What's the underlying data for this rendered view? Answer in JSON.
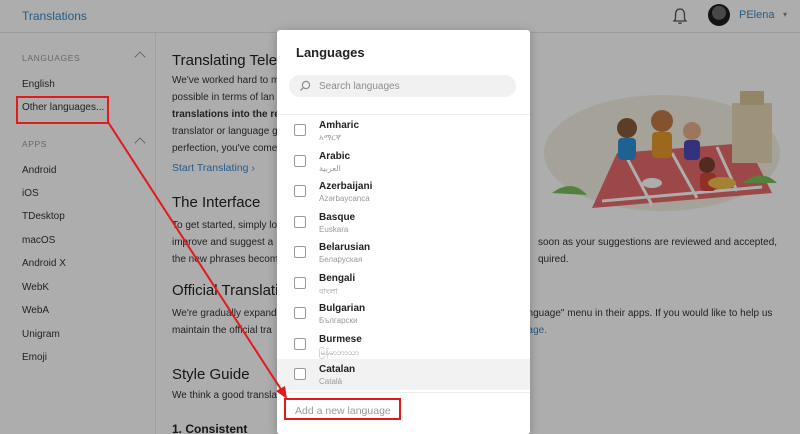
{
  "topbar": {
    "brand": "Translations",
    "username": "PElena",
    "bell_icon": "bell-icon",
    "caret": "▾"
  },
  "sidebar": {
    "languages_heading": "LANGUAGES",
    "languages": [
      "English",
      "Other languages..."
    ],
    "apps_heading": "APPS",
    "apps": [
      "Android",
      "iOS",
      "TDesktop",
      "macOS",
      "Android X",
      "WebK",
      "WebA",
      "Unigram",
      "Emoji"
    ]
  },
  "content": {
    "title_translating": "Translating Teleg",
    "intro_lines": [
      "We've worked hard to m",
      "possible in terms of lan",
      "translations into the res",
      "translator or language g",
      "perfection, you've come"
    ],
    "start_link": "Start Translating ›",
    "title_interface": "The Interface",
    "interface_lines": [
      "To get started, simply lo",
      "improve and suggest a",
      "the new phrases becom"
    ],
    "interface_right_lines": [
      "soon as your suggestions are reviewed and accepted,",
      "quired."
    ],
    "title_official": "Official Translatio",
    "official_lines": [
      "We're gradually expand",
      "maintain the official tra"
    ],
    "official_right_lines": [
      "anguage\" menu in their apps. If you would like to help us",
      "page."
    ],
    "title_style": "Style Guide",
    "style_line": "We think a good transla",
    "title_consistent": "1. Consistent"
  },
  "modal": {
    "title": "Languages",
    "search_placeholder": "Search languages",
    "languages": [
      {
        "name": "Amharic",
        "native": "አማርኛ"
      },
      {
        "name": "Arabic",
        "native": "العربية"
      },
      {
        "name": "Azerbaijani",
        "native": "Azərbaycanca"
      },
      {
        "name": "Basque",
        "native": "Euskara"
      },
      {
        "name": "Belarusian",
        "native": "Беларуская"
      },
      {
        "name": "Bengali",
        "native": "বাংলা"
      },
      {
        "name": "Bulgarian",
        "native": "Български"
      },
      {
        "name": "Burmese",
        "native": "မြန်မာဘာသာ"
      },
      {
        "name": "Catalan",
        "native": "Català"
      }
    ],
    "highlighted_index": 8,
    "footer_label": "Add a new language"
  },
  "colors": {
    "accent": "#3a86c8",
    "annotation": "#e01b1b",
    "overlay": "rgba(0,0,0,0.32)"
  }
}
